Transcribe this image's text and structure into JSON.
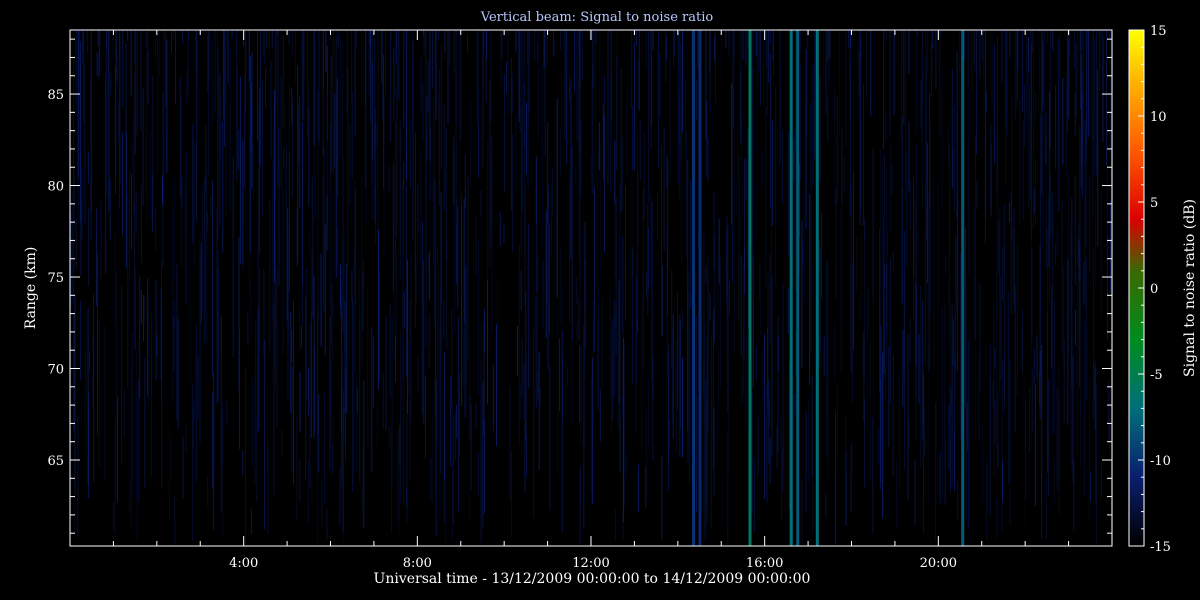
{
  "chart_data": {
    "type": "heatmap",
    "title": "Vertical beam: Signal to noise ratio",
    "xlabel": "Universal time - 13/12/2009 00:00:00 to 14/12/2009 00:00:00",
    "ylabel": "Range (km)",
    "colorbar_label": "Signal to noise ratio (dB)",
    "x_unit": "hours",
    "xlim": [
      0,
      24
    ],
    "ylim": [
      60.3,
      88.5
    ],
    "clim": [
      -15,
      15
    ],
    "x_ticks": [
      {
        "value": 4,
        "label": "4:00"
      },
      {
        "value": 8,
        "label": "8:00"
      },
      {
        "value": 12,
        "label": "12:00"
      },
      {
        "value": 16,
        "label": "16:00"
      },
      {
        "value": 20,
        "label": "20:00"
      }
    ],
    "y_ticks": [
      {
        "value": 65,
        "label": "65"
      },
      {
        "value": 70,
        "label": "70"
      },
      {
        "value": 75,
        "label": "75"
      },
      {
        "value": 80,
        "label": "80"
      },
      {
        "value": 85,
        "label": "85"
      }
    ],
    "colorbar_ticks": [
      {
        "value": 15,
        "label": "15"
      },
      {
        "value": 10,
        "label": "10"
      },
      {
        "value": 5,
        "label": "5"
      },
      {
        "value": 0,
        "label": "0"
      },
      {
        "value": -5,
        "label": "-5"
      },
      {
        "value": -10,
        "label": "-10"
      },
      {
        "value": -15,
        "label": "-15"
      }
    ],
    "background_snr_db": -15,
    "noise_level_db": -12,
    "bright_columns": [
      {
        "time_h": 14.35,
        "snr_db": -10
      },
      {
        "time_h": 14.5,
        "snr_db": -10.5
      },
      {
        "time_h": 15.65,
        "snr_db": -6
      },
      {
        "time_h": 16.6,
        "snr_db": -7
      },
      {
        "time_h": 16.75,
        "snr_db": -8
      },
      {
        "time_h": 17.2,
        "snr_db": -7
      },
      {
        "time_h": 20.55,
        "snr_db": -8
      }
    ],
    "colormap": [
      {
        "value": -15,
        "color": "#000000"
      },
      {
        "value": -11,
        "color": "#0a1e6e"
      },
      {
        "value": -7,
        "color": "#006f7a"
      },
      {
        "value": -3,
        "color": "#008c1e"
      },
      {
        "value": 1,
        "color": "#3a6a00"
      },
      {
        "value": 4,
        "color": "#dc0000"
      },
      {
        "value": 8,
        "color": "#ff5a00"
      },
      {
        "value": 12,
        "color": "#ffb400"
      },
      {
        "value": 15,
        "color": "#ffff00"
      }
    ]
  }
}
